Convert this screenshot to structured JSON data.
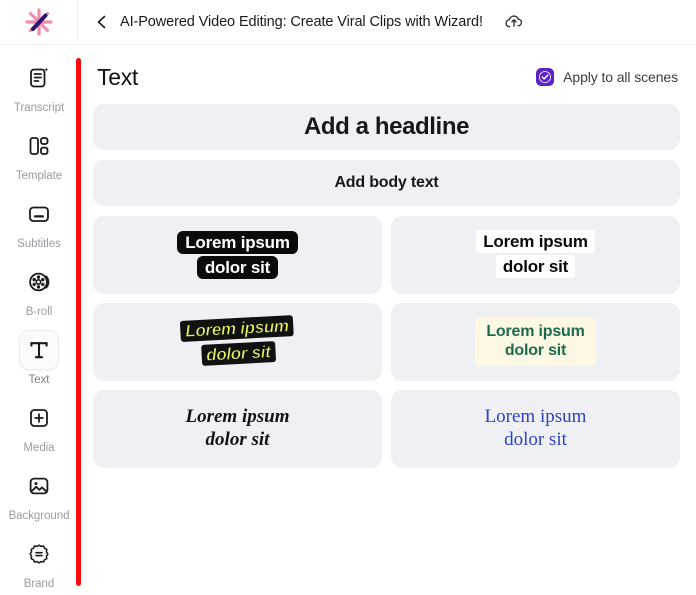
{
  "header": {
    "logo_icon": "sparkle-wand-logo",
    "back_icon": "chevron-left-icon",
    "title": "AI-Powered Video Editing: Create Viral Clips with Wizard!",
    "cloud_icon": "cloud-upload-icon",
    "colors": {
      "logo_pink": "#f58ab3",
      "logo_wand": "#2a1a6e"
    }
  },
  "sidebar": {
    "items": [
      {
        "label": "Transcript",
        "icon": "transcript-icon",
        "active": false
      },
      {
        "label": "Template",
        "icon": "template-icon",
        "active": false
      },
      {
        "label": "Subtitles",
        "icon": "subtitles-icon",
        "active": false
      },
      {
        "label": "B-roll",
        "icon": "film-reel-icon",
        "active": false
      },
      {
        "label": "Text",
        "icon": "text-t-icon",
        "active": true
      },
      {
        "label": "Media",
        "icon": "plus-square-icon",
        "active": false
      },
      {
        "label": "Background",
        "icon": "image-icon",
        "active": false
      },
      {
        "label": "Brand",
        "icon": "badge-seal-icon",
        "active": false
      }
    ],
    "scrollbar_color": "#fb0c0c"
  },
  "panel": {
    "title": "Text",
    "apply_to_all": {
      "label": "Apply to all scenes",
      "checked": true,
      "checkbox_color": "#5b24c6",
      "check_icon": "check-icon"
    },
    "add_headline_label": "Add a headline",
    "add_body_label": "Add body text",
    "text_styles": [
      {
        "id": "style-white-on-black",
        "line1": "Lorem ipsum",
        "line2": "dolor sit",
        "text_color": "#ffffff",
        "background_color": "#0a0a0a"
      },
      {
        "id": "style-black-on-white",
        "line1": "Lorem ipsum",
        "line2": "dolor sit",
        "text_color": "#0a0a0a",
        "background_color": "#ffffff"
      },
      {
        "id": "style-yellow-italic-outline",
        "line1": "Lorem ipsum",
        "line2": "dolor sit",
        "text_color": "#e9f25f",
        "background_color": "#111111"
      },
      {
        "id": "style-green-on-cream",
        "line1": "Lorem ipsum",
        "line2": "dolor sit",
        "text_color": "#1c6b4b",
        "background_color": "#fdf8e3"
      },
      {
        "id": "style-serif-bold-italic",
        "line1": "Lorem ipsum",
        "line2": "dolor sit",
        "text_color": "#121216",
        "background_color": "transparent"
      },
      {
        "id": "style-serif-blue",
        "line1": "Lorem ipsum",
        "line2": "dolor sit",
        "text_color": "#2c43c2",
        "background_color": "transparent"
      }
    ]
  }
}
